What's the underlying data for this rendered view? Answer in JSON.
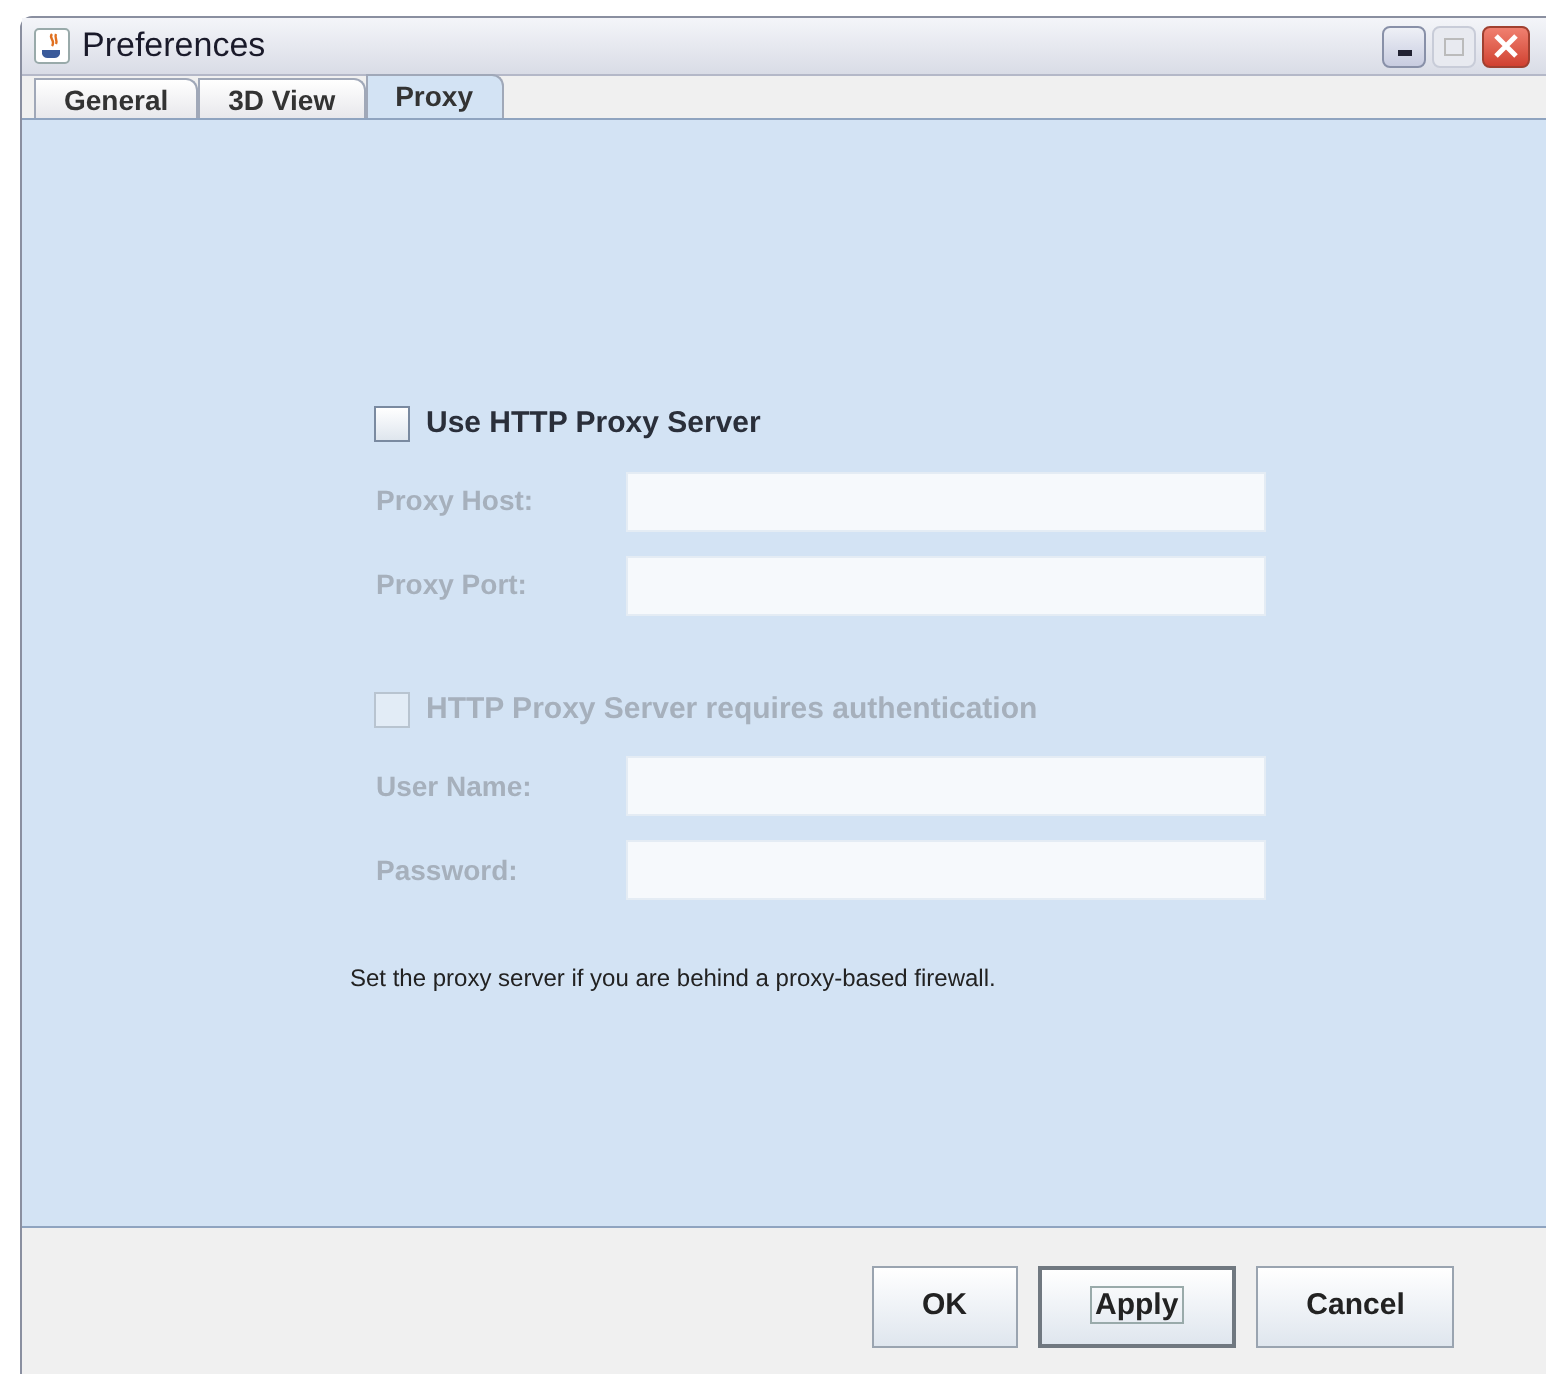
{
  "window": {
    "title": "Preferences"
  },
  "tabs": [
    {
      "label": "General",
      "selected": false
    },
    {
      "label": "3D View",
      "selected": false
    },
    {
      "label": "Proxy",
      "selected": true
    }
  ],
  "proxy": {
    "use_proxy": {
      "label": "Use HTTP Proxy Server",
      "checked": false,
      "disabled": false
    },
    "host": {
      "label": "Proxy Host:",
      "disabled": true
    },
    "port": {
      "label": "Proxy Port:",
      "disabled": true
    },
    "auth": {
      "label": "HTTP Proxy Server requires authentication",
      "checked": false,
      "disabled": true
    },
    "user": {
      "label": "User Name:",
      "disabled": true
    },
    "password": {
      "label": "Password:",
      "disabled": true
    },
    "note": "Set the proxy server if you are behind a proxy-based firewall."
  },
  "buttons": [
    {
      "label": "OK",
      "focused": false
    },
    {
      "label": "Apply",
      "focused": true
    },
    {
      "label": "Cancel",
      "focused": false
    }
  ]
}
